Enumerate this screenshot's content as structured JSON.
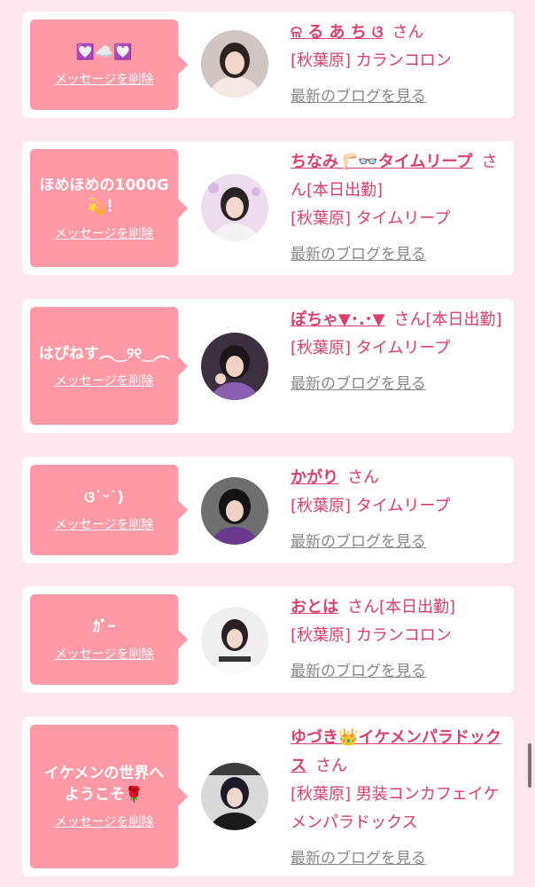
{
  "delete_label": "メッセージを削除",
  "blog_label": "最新のブログを見る",
  "cards": [
    {
      "message": "💟☁️💟",
      "name": "ଳ る あ ち ଓ",
      "suffix": "さん",
      "shop": "[秋葉原] カランコロン"
    },
    {
      "message": "ほめほめの1000G💫！",
      "name": "ちなみ🦵🏻👓タイムリープ",
      "suffix": "さん[本日出勤]",
      "shop": "[秋葉原] タイムリープ"
    },
    {
      "message": "はぴねす︵‿୨୧‿︵",
      "name": "ぽちゃ▼･.･▼",
      "suffix": "さん[本日出勤]",
      "shop": "[秋葉原] タイムリープ"
    },
    {
      "message": "ଓ˙ᵕ˙)",
      "name": "かがり",
      "suffix": "さん",
      "shop": "[秋葉原] タイムリープ"
    },
    {
      "message": "ｶﾞｰ",
      "name": "おとは",
      "suffix": "さん[本日出勤]",
      "shop": "[秋葉原] カランコロン"
    },
    {
      "message": "イケメンの世界へようこそ🌹",
      "name": "ゆづき👑イケメンパラドックス",
      "suffix": "さん",
      "shop": "[秋葉原] 男装コンカフェイケメンパラドックス"
    }
  ],
  "colors": {
    "background": "#ffe6ee",
    "bubble": "#fe99a5",
    "accent": "#d9406b",
    "muted_link": "#888888"
  }
}
